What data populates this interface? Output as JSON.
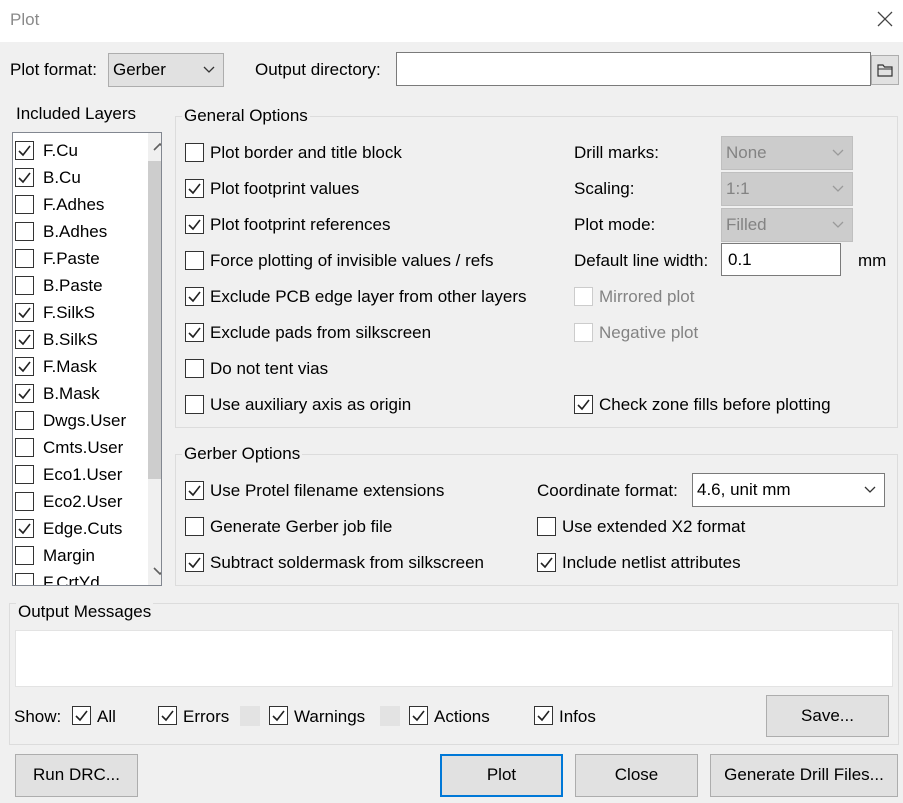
{
  "window": {
    "title": "Plot"
  },
  "top": {
    "plot_format_label": "Plot format:",
    "plot_format_value": "Gerber",
    "output_dir_label": "Output directory:",
    "output_dir_value": ""
  },
  "layers": {
    "title": "Included Layers",
    "items": [
      {
        "label": "F.Cu",
        "checked": true
      },
      {
        "label": "B.Cu",
        "checked": true
      },
      {
        "label": "F.Adhes",
        "checked": false
      },
      {
        "label": "B.Adhes",
        "checked": false
      },
      {
        "label": "F.Paste",
        "checked": false
      },
      {
        "label": "B.Paste",
        "checked": false
      },
      {
        "label": "F.SilkS",
        "checked": true
      },
      {
        "label": "B.SilkS",
        "checked": true
      },
      {
        "label": "F.Mask",
        "checked": true
      },
      {
        "label": "B.Mask",
        "checked": true
      },
      {
        "label": "Dwgs.User",
        "checked": false
      },
      {
        "label": "Cmts.User",
        "checked": false
      },
      {
        "label": "Eco1.User",
        "checked": false
      },
      {
        "label": "Eco2.User",
        "checked": false
      },
      {
        "label": "Edge.Cuts",
        "checked": true
      },
      {
        "label": "Margin",
        "checked": false
      },
      {
        "label": "F.CrtYd",
        "checked": false
      }
    ]
  },
  "general": {
    "title": "General Options",
    "options": [
      {
        "label": "Plot border and title block",
        "checked": false
      },
      {
        "label": "Plot footprint values",
        "checked": true
      },
      {
        "label": "Plot footprint references",
        "checked": true
      },
      {
        "label": "Force plotting of invisible values / refs",
        "checked": false
      },
      {
        "label": "Exclude PCB edge layer from other layers",
        "checked": true
      },
      {
        "label": "Exclude pads from silkscreen",
        "checked": true
      },
      {
        "label": "Do not tent vias",
        "checked": false
      },
      {
        "label": "Use auxiliary axis as origin",
        "checked": false
      }
    ],
    "drill_marks_label": "Drill marks:",
    "drill_marks_value": "None",
    "scaling_label": "Scaling:",
    "scaling_value": "1:1",
    "plot_mode_label": "Plot mode:",
    "plot_mode_value": "Filled",
    "line_width_label": "Default line width:",
    "line_width_value": "0.1",
    "line_width_unit": "mm",
    "mirrored_label": "Mirrored plot",
    "mirrored_checked": false,
    "negative_label": "Negative plot",
    "negative_checked": false,
    "check_zone_label": "Check zone fills before plotting",
    "check_zone_checked": true
  },
  "gerber": {
    "title": "Gerber Options",
    "protel_label": "Use Protel filename extensions",
    "protel_checked": true,
    "job_file_label": "Generate Gerber job file",
    "job_file_checked": false,
    "subtract_label": "Subtract soldermask from silkscreen",
    "subtract_checked": true,
    "coord_label": "Coordinate format:",
    "coord_value": "4.6, unit mm",
    "x2_label": "Use extended X2 format",
    "x2_checked": false,
    "netlist_label": "Include netlist attributes",
    "netlist_checked": true
  },
  "messages": {
    "title": "Output Messages",
    "show_label": "Show:",
    "filters": [
      {
        "label": "All",
        "checked": true
      },
      {
        "label": "Errors",
        "checked": true
      },
      {
        "label": "Warnings",
        "checked": true
      },
      {
        "label": "Actions",
        "checked": true
      },
      {
        "label": "Infos",
        "checked": true
      }
    ],
    "save_label": "Save..."
  },
  "buttons": {
    "run_drc": "Run DRC...",
    "plot": "Plot",
    "close": "Close",
    "drill": "Generate Drill Files..."
  },
  "colors": {
    "accent": "#0078d7",
    "background": "#f0f0f0"
  }
}
